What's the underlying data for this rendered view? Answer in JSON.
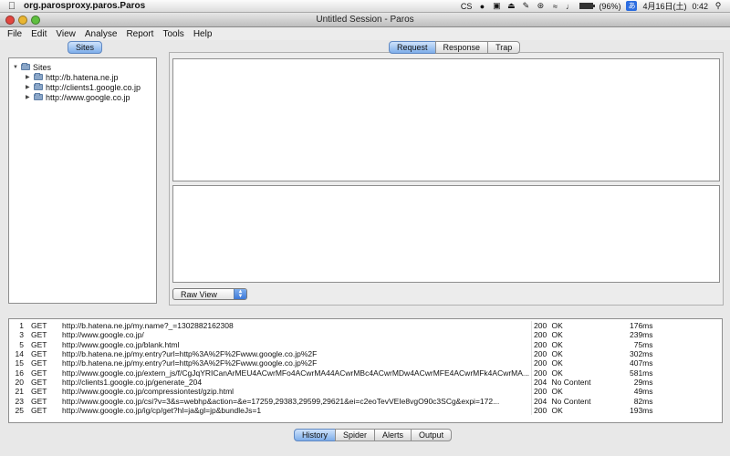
{
  "menubar": {
    "app_name": "org.parosproxy.paros.Paros",
    "battery_percent": 96,
    "battery_label": "(96%)",
    "date": "4月16日(土)",
    "time": "0:42",
    "ime_label": "あ",
    "status_icon_label": "CS"
  },
  "window": {
    "title": "Untitled Session - Paros"
  },
  "app_menu": {
    "file": "File",
    "edit": "Edit",
    "view": "View",
    "analyse": "Analyse",
    "report": "Report",
    "tools": "Tools",
    "help": "Help"
  },
  "sites": {
    "tab_label": "Sites",
    "root": "Sites",
    "items": [
      "http://b.hatena.ne.jp",
      "http://clients1.google.co.jp",
      "http://www.google.co.jp"
    ]
  },
  "request_tabs": {
    "request": "Request",
    "response": "Response",
    "trap": "Trap",
    "selected": "Request"
  },
  "view_select": {
    "value": "Raw View"
  },
  "history": {
    "rows": [
      {
        "id": "1",
        "method": "GET",
        "url": "http://b.hatena.ne.jp/my.name?_=1302882162308",
        "code": "200",
        "reason": "OK",
        "time": "176ms"
      },
      {
        "id": "3",
        "method": "GET",
        "url": "http://www.google.co.jp/",
        "code": "200",
        "reason": "OK",
        "time": "239ms"
      },
      {
        "id": "5",
        "method": "GET",
        "url": "http://www.google.co.jp/blank.html",
        "code": "200",
        "reason": "OK",
        "time": "75ms"
      },
      {
        "id": "14",
        "method": "GET",
        "url": "http://b.hatena.ne.jp/my.entry?url=http%3A%2F%2Fwww.google.co.jp%2F",
        "code": "200",
        "reason": "OK",
        "time": "302ms"
      },
      {
        "id": "15",
        "method": "GET",
        "url": "http://b.hatena.ne.jp/my.entry?url=http%3A%2F%2Fwww.google.co.jp%2F",
        "code": "200",
        "reason": "OK",
        "time": "407ms"
      },
      {
        "id": "16",
        "method": "GET",
        "url": "http://www.google.co.jp/extern_js/f/CgJqYRICanArMEU4ACwrMFo4ACwrMA44ACwrMBc4ACwrMDw4ACwrMFE4ACwrMFk4ACwrMA...",
        "code": "200",
        "reason": "OK",
        "time": "581ms"
      },
      {
        "id": "20",
        "method": "GET",
        "url": "http://clients1.google.co.jp/generate_204",
        "code": "204",
        "reason": "No Content",
        "time": "29ms"
      },
      {
        "id": "21",
        "method": "GET",
        "url": "http://www.google.co.jp/compressiontest/gzip.html",
        "code": "200",
        "reason": "OK",
        "time": "49ms"
      },
      {
        "id": "23",
        "method": "GET",
        "url": "http://www.google.co.jp/csi?v=3&s=webhp&action=&e=17259,29383,29599,29621&ei=c2eoTevVEIe8vgO90c3SCg&expi=172...",
        "code": "204",
        "reason": "No Content",
        "time": "82ms"
      },
      {
        "id": "25",
        "method": "GET",
        "url": "http://www.google.co.jp/ig/cp/get?hl=ja&gl=jp&bundleJs=1",
        "code": "200",
        "reason": "OK",
        "time": "193ms"
      }
    ]
  },
  "bottom_tabs": {
    "history": "History",
    "spider": "Spider",
    "alerts": "Alerts",
    "output": "Output",
    "selected": "History"
  },
  "colors": {
    "tab_selected": "#7eaeea",
    "close": "#e2463f",
    "minimize": "#e9b531",
    "zoom": "#5fbf3f",
    "folder": "#8aa6c8",
    "ime": "#2c6de0"
  }
}
